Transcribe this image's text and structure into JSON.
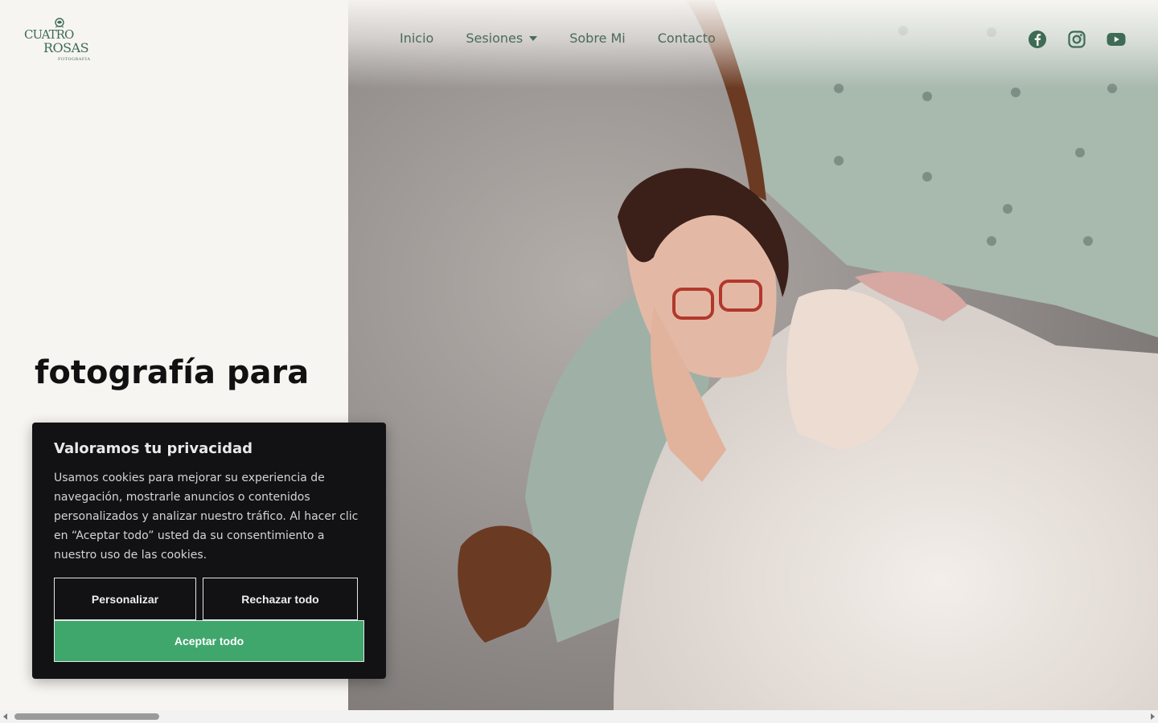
{
  "brand": {
    "logo_line1": "CUATRO",
    "logo_line2": "ROSAS",
    "logo_line3": "FOTOGRAFÍA",
    "color": "#3d6b55"
  },
  "nav": {
    "items": [
      {
        "label": "Inicio"
      },
      {
        "label": "Sesiones",
        "has_dropdown": true
      },
      {
        "label": "Sobre Mi"
      },
      {
        "label": "Contacto"
      }
    ]
  },
  "social": [
    {
      "icon": "facebook-icon"
    },
    {
      "icon": "instagram-icon"
    },
    {
      "icon": "youtube-icon"
    }
  ],
  "hero": {
    "headline_bold": "fotografía",
    "headline_rest": " para"
  },
  "cookie_banner": {
    "title": "Valoramos tu privacidad",
    "text": "Usamos cookies para mejorar su experiencia de navegación, mostrarle anuncios o contenidos personalizados y analizar nuestro tráfico. Al hacer clic en “Aceptar todo” usted da su consentimiento a nuestro uso de las cookies.",
    "customize_label": "Personalizar",
    "reject_label": "Rechazar todo",
    "accept_label": "Aceptar todo",
    "accept_color": "#3fa76c"
  }
}
